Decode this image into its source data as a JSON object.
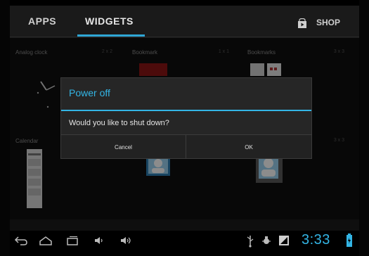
{
  "tabs": {
    "apps_label": "APPS",
    "widgets_label": "WIDGETS",
    "shop_label": "SHOP"
  },
  "widgets": [
    {
      "title": "Analog clock",
      "size": "2 x 2"
    },
    {
      "title": "Bookmark",
      "size": "1 x 1"
    },
    {
      "title": "Bookmarks",
      "size": "3 x 3"
    },
    {
      "title": "Calendar",
      "size": ""
    },
    {
      "title": "",
      "size": ""
    },
    {
      "title": "",
      "size": "3 x 3"
    }
  ],
  "dialog": {
    "title": "Power off",
    "message": "Would you like to shut down?",
    "cancel_label": "Cancel",
    "ok_label": "OK"
  },
  "status": {
    "clock": "3:33"
  },
  "colors": {
    "accent": "#33b5e5"
  }
}
